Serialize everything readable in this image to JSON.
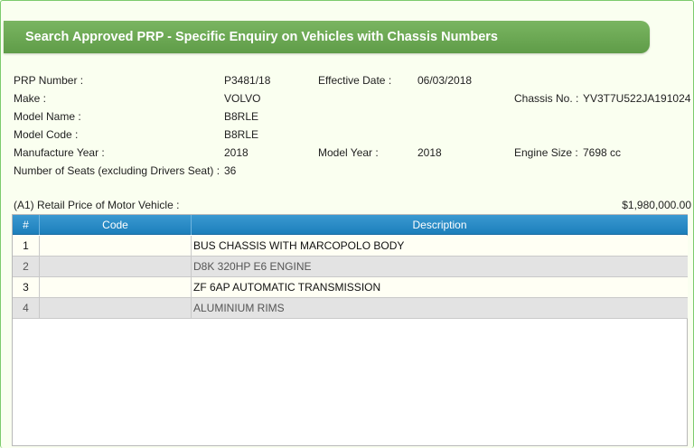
{
  "window": {
    "title": "Search Approved PRP - Specific Enquiry on Vehicles with Chassis Numbers"
  },
  "details": {
    "prp_number_label": "PRP Number :",
    "prp_number": "P3481/18",
    "effective_date_label": "Effective Date :",
    "effective_date": "06/03/2018",
    "make_label": "Make :",
    "make": "VOLVO",
    "chassis_label": "Chassis No. :",
    "chassis": "YV3T7U522JA191024",
    "model_name_label": "Model Name :",
    "model_name": "B8RLE",
    "model_code_label": "Model Code :",
    "model_code": "B8RLE",
    "manufacture_year_label": "Manufacture Year :",
    "manufacture_year": "2018",
    "model_year_label": "Model Year :",
    "model_year": "2018",
    "engine_size_label": "Engine Size :",
    "engine_size": "7698 cc",
    "seats_label": "Number of Seats (excluding Drivers Seat) :",
    "seats": "36"
  },
  "price": {
    "label": "(A1) Retail Price of Motor Vehicle :",
    "value": "$1,980,000.00"
  },
  "grid": {
    "columns": [
      "#",
      "Code",
      "Description"
    ],
    "rows": [
      {
        "num": "1",
        "code": "",
        "desc": "BUS CHASSIS WITH MARCOPOLO BODY"
      },
      {
        "num": "2",
        "code": "",
        "desc": "D8K 320HP E6 ENGINE"
      },
      {
        "num": "3",
        "code": "",
        "desc": "ZF 6AP AUTOMATIC TRANSMISSION"
      },
      {
        "num": "4",
        "code": "",
        "desc": "ALUMINIUM RIMS"
      }
    ]
  },
  "colors": {
    "title_bar": "#6aa853",
    "grid_header": "#2a8cc7",
    "page_bg": "#fafff0"
  }
}
